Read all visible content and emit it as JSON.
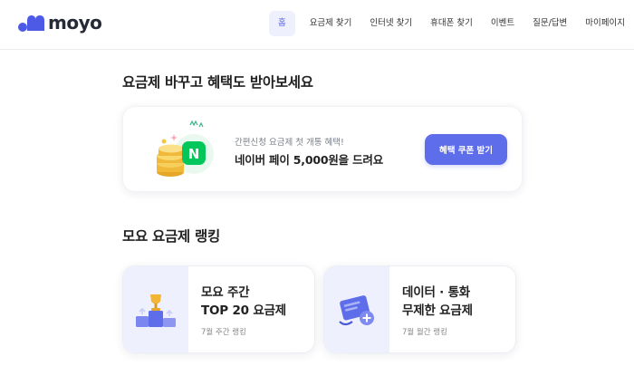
{
  "header": {
    "logo_text": "moyo",
    "nav": [
      {
        "label": "홈",
        "active": true
      },
      {
        "label": "요금제 찾기"
      },
      {
        "label": "인터넷 찾기"
      },
      {
        "label": "휴대폰 찾기"
      },
      {
        "label": "이벤트"
      },
      {
        "label": "질문/답변"
      },
      {
        "label": "마이페이지"
      }
    ]
  },
  "coupon_section": {
    "title": "요금제 바꾸고 혜택도 받아보세요",
    "subtitle": "간편신청 요금제 첫 개통 혜택!",
    "headline": "네이버 페이 5,000원을 드려요",
    "button_label": "혜택 쿠폰 받기",
    "badge_letter": "N"
  },
  "ranking_section": {
    "title": "모요 요금제 랭킹",
    "cards": [
      {
        "title": "모요 주간\nTOP 20 요금제",
        "subtitle": "7월 주간 랭킹",
        "icon": "trophy-podium-icon"
      },
      {
        "title": "데이터 · 통화\n무제한 요금제",
        "subtitle": "7월 월간 랭킹",
        "icon": "infinity-card-icon"
      }
    ]
  },
  "colors": {
    "accent": "#5e6de9",
    "nav_active_bg": "#eef0fd",
    "naver_green": "#03c75a"
  }
}
